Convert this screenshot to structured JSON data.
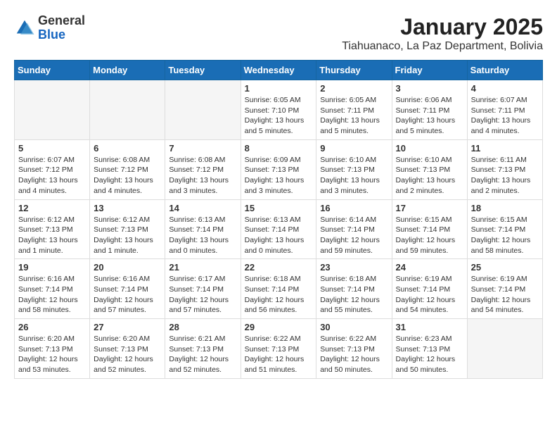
{
  "header": {
    "logo_general": "General",
    "logo_blue": "Blue",
    "month": "January 2025",
    "location": "Tiahuanaco, La Paz Department, Bolivia"
  },
  "weekdays": [
    "Sunday",
    "Monday",
    "Tuesday",
    "Wednesday",
    "Thursday",
    "Friday",
    "Saturday"
  ],
  "weeks": [
    [
      {
        "day": "",
        "info": ""
      },
      {
        "day": "",
        "info": ""
      },
      {
        "day": "",
        "info": ""
      },
      {
        "day": "1",
        "info": "Sunrise: 6:05 AM\nSunset: 7:10 PM\nDaylight: 13 hours\nand 5 minutes."
      },
      {
        "day": "2",
        "info": "Sunrise: 6:05 AM\nSunset: 7:11 PM\nDaylight: 13 hours\nand 5 minutes."
      },
      {
        "day": "3",
        "info": "Sunrise: 6:06 AM\nSunset: 7:11 PM\nDaylight: 13 hours\nand 5 minutes."
      },
      {
        "day": "4",
        "info": "Sunrise: 6:07 AM\nSunset: 7:11 PM\nDaylight: 13 hours\nand 4 minutes."
      }
    ],
    [
      {
        "day": "5",
        "info": "Sunrise: 6:07 AM\nSunset: 7:12 PM\nDaylight: 13 hours\nand 4 minutes."
      },
      {
        "day": "6",
        "info": "Sunrise: 6:08 AM\nSunset: 7:12 PM\nDaylight: 13 hours\nand 4 minutes."
      },
      {
        "day": "7",
        "info": "Sunrise: 6:08 AM\nSunset: 7:12 PM\nDaylight: 13 hours\nand 3 minutes."
      },
      {
        "day": "8",
        "info": "Sunrise: 6:09 AM\nSunset: 7:13 PM\nDaylight: 13 hours\nand 3 minutes."
      },
      {
        "day": "9",
        "info": "Sunrise: 6:10 AM\nSunset: 7:13 PM\nDaylight: 13 hours\nand 3 minutes."
      },
      {
        "day": "10",
        "info": "Sunrise: 6:10 AM\nSunset: 7:13 PM\nDaylight: 13 hours\nand 2 minutes."
      },
      {
        "day": "11",
        "info": "Sunrise: 6:11 AM\nSunset: 7:13 PM\nDaylight: 13 hours\nand 2 minutes."
      }
    ],
    [
      {
        "day": "12",
        "info": "Sunrise: 6:12 AM\nSunset: 7:13 PM\nDaylight: 13 hours\nand 1 minute."
      },
      {
        "day": "13",
        "info": "Sunrise: 6:12 AM\nSunset: 7:13 PM\nDaylight: 13 hours\nand 1 minute."
      },
      {
        "day": "14",
        "info": "Sunrise: 6:13 AM\nSunset: 7:14 PM\nDaylight: 13 hours\nand 0 minutes."
      },
      {
        "day": "15",
        "info": "Sunrise: 6:13 AM\nSunset: 7:14 PM\nDaylight: 13 hours\nand 0 minutes."
      },
      {
        "day": "16",
        "info": "Sunrise: 6:14 AM\nSunset: 7:14 PM\nDaylight: 12 hours\nand 59 minutes."
      },
      {
        "day": "17",
        "info": "Sunrise: 6:15 AM\nSunset: 7:14 PM\nDaylight: 12 hours\nand 59 minutes."
      },
      {
        "day": "18",
        "info": "Sunrise: 6:15 AM\nSunset: 7:14 PM\nDaylight: 12 hours\nand 58 minutes."
      }
    ],
    [
      {
        "day": "19",
        "info": "Sunrise: 6:16 AM\nSunset: 7:14 PM\nDaylight: 12 hours\nand 58 minutes."
      },
      {
        "day": "20",
        "info": "Sunrise: 6:16 AM\nSunset: 7:14 PM\nDaylight: 12 hours\nand 57 minutes."
      },
      {
        "day": "21",
        "info": "Sunrise: 6:17 AM\nSunset: 7:14 PM\nDaylight: 12 hours\nand 57 minutes."
      },
      {
        "day": "22",
        "info": "Sunrise: 6:18 AM\nSunset: 7:14 PM\nDaylight: 12 hours\nand 56 minutes."
      },
      {
        "day": "23",
        "info": "Sunrise: 6:18 AM\nSunset: 7:14 PM\nDaylight: 12 hours\nand 55 minutes."
      },
      {
        "day": "24",
        "info": "Sunrise: 6:19 AM\nSunset: 7:14 PM\nDaylight: 12 hours\nand 54 minutes."
      },
      {
        "day": "25",
        "info": "Sunrise: 6:19 AM\nSunset: 7:14 PM\nDaylight: 12 hours\nand 54 minutes."
      }
    ],
    [
      {
        "day": "26",
        "info": "Sunrise: 6:20 AM\nSunset: 7:13 PM\nDaylight: 12 hours\nand 53 minutes."
      },
      {
        "day": "27",
        "info": "Sunrise: 6:20 AM\nSunset: 7:13 PM\nDaylight: 12 hours\nand 52 minutes."
      },
      {
        "day": "28",
        "info": "Sunrise: 6:21 AM\nSunset: 7:13 PM\nDaylight: 12 hours\nand 52 minutes."
      },
      {
        "day": "29",
        "info": "Sunrise: 6:22 AM\nSunset: 7:13 PM\nDaylight: 12 hours\nand 51 minutes."
      },
      {
        "day": "30",
        "info": "Sunrise: 6:22 AM\nSunset: 7:13 PM\nDaylight: 12 hours\nand 50 minutes."
      },
      {
        "day": "31",
        "info": "Sunrise: 6:23 AM\nSunset: 7:13 PM\nDaylight: 12 hours\nand 50 minutes."
      },
      {
        "day": "",
        "info": ""
      }
    ]
  ]
}
